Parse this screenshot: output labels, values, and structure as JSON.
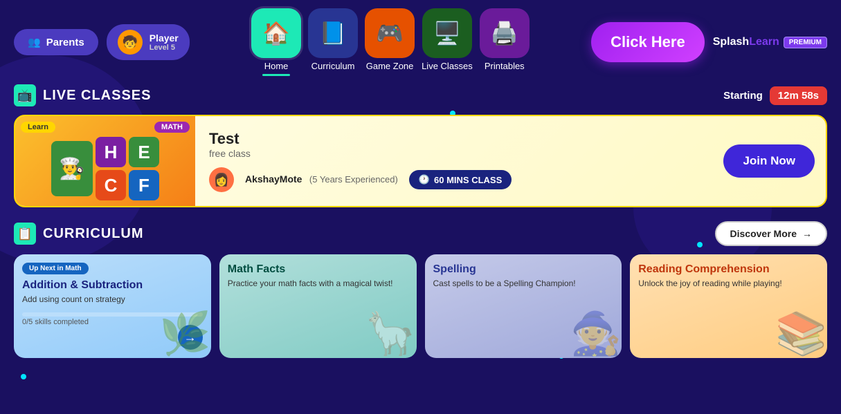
{
  "header": {
    "parents_label": "Parents",
    "player_name": "Player",
    "player_level": "Level 5",
    "clickhere_label": "Click Here",
    "splashlearn_label": "SplashLearn",
    "premium_label": "PREMIUM",
    "parents_icon": "👥"
  },
  "nav": {
    "items": [
      {
        "id": "home",
        "label": "Home",
        "icon": "🏠",
        "active": true
      },
      {
        "id": "curriculum",
        "label": "Curriculum",
        "icon": "📘",
        "active": false
      },
      {
        "id": "gamezone",
        "label": "Game Zone",
        "icon": "🎮",
        "active": false
      },
      {
        "id": "liveclasses",
        "label": "Live Classes",
        "icon": "🖥️",
        "active": false
      },
      {
        "id": "printables",
        "label": "Printables",
        "icon": "🖨️",
        "active": false
      }
    ]
  },
  "live_classes": {
    "section_title": "LIVE CLASSES",
    "starting_label": "Starting",
    "timer": "12m 58s",
    "card": {
      "thumbnail_label_learn": "Learn",
      "thumbnail_label_math": "MATH",
      "letters": [
        "H",
        "E",
        "C",
        "F"
      ],
      "title": "Test",
      "subtitle": "free class",
      "teacher_name": "AkshayMote",
      "teacher_exp": "(5 Years Experienced)",
      "duration": "60 MINS CLASS",
      "join_label": "Join Now"
    }
  },
  "curriculum": {
    "section_title": "CURRICULUM",
    "discover_label": "Discover More",
    "cards": [
      {
        "badge": "Up Next in Math",
        "title": "Addition & Subtraction",
        "subtitle": "Add using count on strategy",
        "progress_text": "0/5 skills completed",
        "progress_pct": 0,
        "deco": "🌿"
      },
      {
        "title": "Math Facts",
        "subtitle": "Practice your math facts with a magical twist!",
        "deco": "🦙"
      },
      {
        "title": "Spelling",
        "subtitle": "Cast spells to be a Spelling Champion!",
        "deco": "🧙"
      },
      {
        "title": "Reading Comprehension",
        "subtitle": "Unlock the joy of reading while playing!",
        "deco": "📚"
      }
    ]
  }
}
